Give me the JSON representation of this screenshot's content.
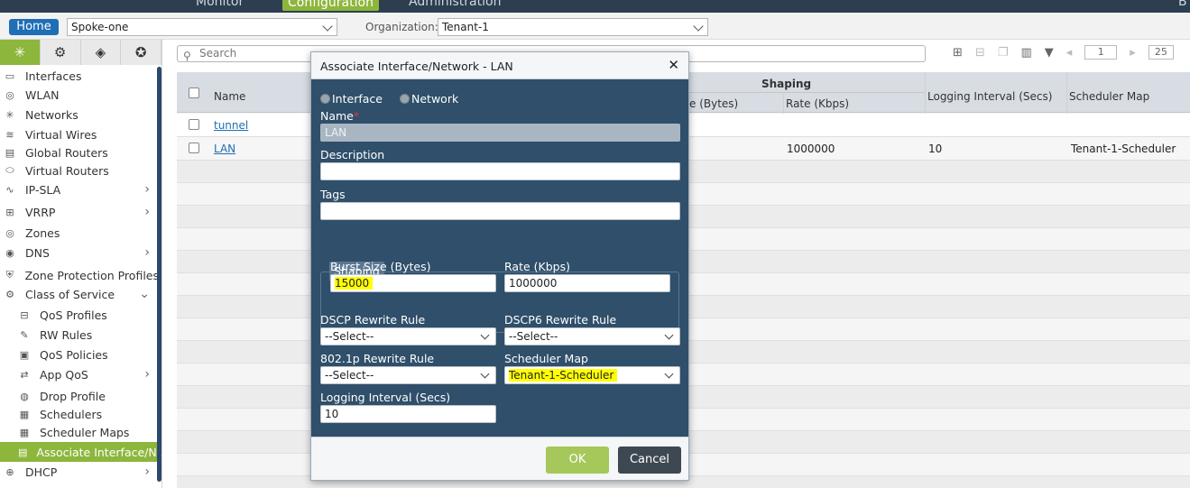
{
  "topnav": {
    "tabs": [
      "Monitor",
      "Configuration",
      "Administration"
    ],
    "right_text": "B"
  },
  "header": {
    "home_label": "Home",
    "appliance": "Spoke-one",
    "org_label": "Organization:",
    "organization": "Tenant-1"
  },
  "sidebar": {
    "items": [
      {
        "label": "Interfaces",
        "icon": "interfaces-icon"
      },
      {
        "label": "WLAN",
        "icon": "wlan-icon"
      },
      {
        "label": "Networks",
        "icon": "networks-icon"
      },
      {
        "label": "Virtual Wires",
        "icon": "virtual-wires-icon"
      },
      {
        "label": "Global Routers",
        "icon": "global-routers-icon"
      },
      {
        "label": "Virtual Routers",
        "icon": "virtual-routers-icon"
      },
      {
        "label": "IP-SLA",
        "icon": "ip-sla-icon"
      },
      {
        "label": "VRRP",
        "icon": "vrrp-icon"
      },
      {
        "label": "Zones",
        "icon": "zones-icon"
      },
      {
        "label": "DNS",
        "icon": "dns-icon"
      },
      {
        "label": "Zone Protection Profiles",
        "icon": "zone-protection-icon"
      },
      {
        "label": "Class of Service",
        "icon": "class-of-service-icon"
      },
      {
        "label": "QoS Profiles",
        "icon": "qos-profiles-icon"
      },
      {
        "label": "RW Rules",
        "icon": "rw-rules-icon"
      },
      {
        "label": "QoS Policies",
        "icon": "qos-policies-icon"
      },
      {
        "label": "App QoS",
        "icon": "app-qos-icon"
      },
      {
        "label": "Drop Profile",
        "icon": "drop-profile-icon"
      },
      {
        "label": "Schedulers",
        "icon": "schedulers-icon"
      },
      {
        "label": "Scheduler Maps",
        "icon": "scheduler-maps-icon"
      },
      {
        "label": "Associate Interface/N...",
        "icon": "associate-interface-icon"
      },
      {
        "label": "DHCP",
        "icon": "dhcp-icon"
      }
    ]
  },
  "toolbar": {
    "search_placeholder": "Search",
    "page": "1",
    "page_size": "25"
  },
  "grid": {
    "columns": {
      "name": "Name",
      "shaping_group": "Shaping",
      "burst_size": "e (Bytes)",
      "rate": "Rate (Kbps)",
      "logging_interval": "Logging Interval (Secs)",
      "scheduler_map": "Scheduler Map"
    },
    "rows": [
      {
        "name": "tunnel",
        "rate": "",
        "logging": "",
        "scheduler": ""
      },
      {
        "name": "LAN",
        "rate": "1000000",
        "logging": "10",
        "scheduler": "Tenant-1-Scheduler"
      }
    ]
  },
  "modal": {
    "title": "Associate Interface/Network - LAN",
    "radio_interface": "Interface",
    "radio_network": "Network",
    "name_label": "Name",
    "name_required": "*",
    "name_value": "LAN",
    "description_label": "Description",
    "description_value": "",
    "tags_label": "Tags",
    "tags_value": "",
    "shaping_legend": "Shaping",
    "burst_label": "Burst Size (Bytes)",
    "burst_value": "15000",
    "rate_label": "Rate (Kbps)",
    "rate_value": "1000000",
    "dscp_label": "DSCP Rewrite Rule",
    "dscp_value": "--Select--",
    "dscp6_label": "DSCP6 Rewrite Rule",
    "dscp6_value": "--Select--",
    "dot1p_label": "802.1p Rewrite Rule",
    "dot1p_value": "--Select--",
    "scheduler_label": "Scheduler Map",
    "scheduler_value": "Tenant-1-Scheduler",
    "logging_label": "Logging Interval (Secs)",
    "logging_value": "10",
    "ok_label": "OK",
    "cancel_label": "Cancel"
  },
  "colors": {
    "accent_green": "#8db63c",
    "modal_bg": "#2f4f6a",
    "highlight": "#ffff00",
    "home_blue": "#1e6fb5"
  }
}
